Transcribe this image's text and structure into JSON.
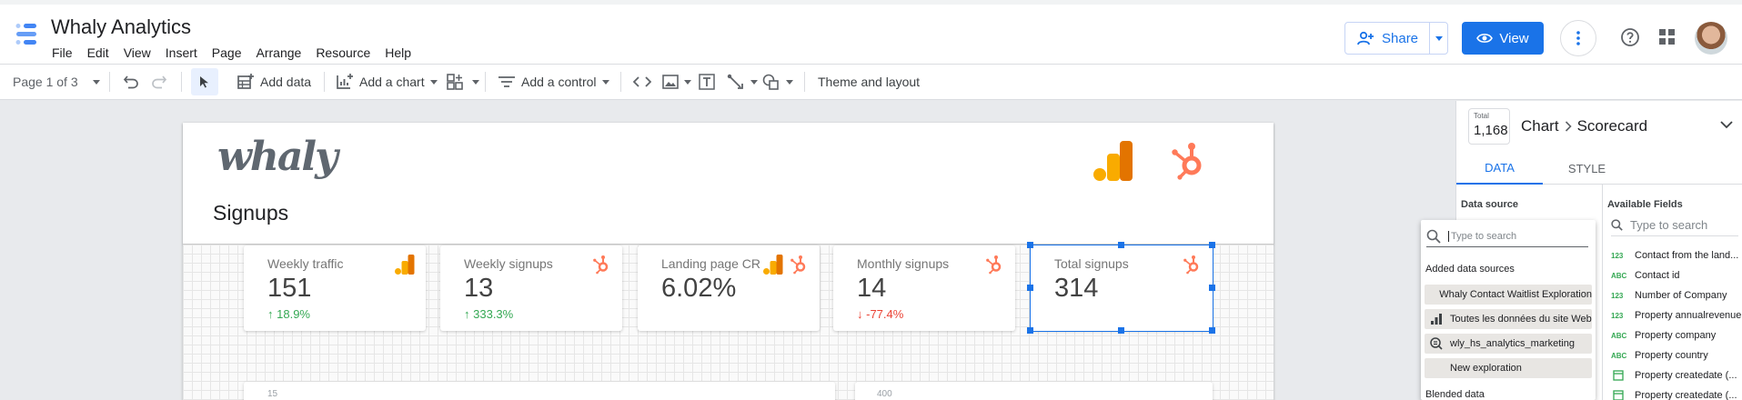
{
  "app": {
    "title": "Whaly Analytics"
  },
  "menu": [
    "File",
    "Edit",
    "View",
    "Insert",
    "Page",
    "Arrange",
    "Resource",
    "Help"
  ],
  "header": {
    "share_label": "Share",
    "view_label": "View"
  },
  "toolbar": {
    "page_selector": "Page 1 of 3",
    "add_data": "Add data",
    "add_chart": "Add a chart",
    "add_control": "Add a control",
    "theme_layout": "Theme and layout"
  },
  "report": {
    "logo_text": "whaly",
    "heading": "Signups",
    "scorecards": [
      {
        "label": "Weekly traffic",
        "value": "151",
        "change": "18.9%",
        "direction": "up",
        "source": "analytics-icon"
      },
      {
        "label": "Weekly signups",
        "value": "13",
        "change": "333.3%",
        "direction": "up",
        "source": "hubspot-icon"
      },
      {
        "label": "Landing page CR",
        "value": "6.02%",
        "change": "",
        "direction": "none",
        "source": "analytics-and-hubspot-icons"
      },
      {
        "label": "Monthly signups",
        "value": "14",
        "change": "-77.4%",
        "direction": "down",
        "source": "hubspot-icon"
      },
      {
        "label": "Total signups",
        "value": "314",
        "change": "",
        "direction": "none",
        "source": "hubspot-icon"
      }
    ],
    "lower_cards": [
      {
        "axis_text": "15"
      },
      {
        "axis_text": "400"
      }
    ]
  },
  "panel": {
    "mini_total_label": "Total",
    "mini_total_value": "1,168",
    "breadcrumb_chart": "Chart",
    "breadcrumb_type": "Scorecard",
    "tabs": [
      "DATA",
      "STYLE"
    ],
    "data_source_label": "Data source",
    "available_fields_label": "Available Fields",
    "fields_search_placeholder": "Type to search",
    "fields": [
      {
        "type": "123",
        "name": "Contact from the land..."
      },
      {
        "type": "ABC",
        "name": "Contact id"
      },
      {
        "type": "123",
        "name": "Number of Company"
      },
      {
        "type": "123",
        "name": "Property annualrevenue"
      },
      {
        "type": "ABC",
        "name": "Property company"
      },
      {
        "type": "ABC",
        "name": "Property country"
      },
      {
        "type": "date",
        "name": "Property createdate (..."
      },
      {
        "type": "date",
        "name": "Property createdate (..."
      }
    ]
  },
  "ds_popup": {
    "search_placeholder": "Type to search",
    "added_label": "Added data sources",
    "items": [
      {
        "icon": "",
        "name": "Whaly Contact Waitlist Exploration"
      },
      {
        "icon": "bar-chart-icon",
        "name": "Toutes les données du site Web"
      },
      {
        "icon": "search-db-icon",
        "name": "wly_hs_analytics_marketing"
      },
      {
        "icon": "",
        "name": "New exploration"
      }
    ],
    "blended_label": "Blended data"
  },
  "colors": {
    "accent": "#1a73e8",
    "ga_orange": "#f9ab00",
    "ga_dark": "#e37400",
    "hubspot": "#ff7a59",
    "up": "#34a853",
    "down": "#ea4335"
  }
}
